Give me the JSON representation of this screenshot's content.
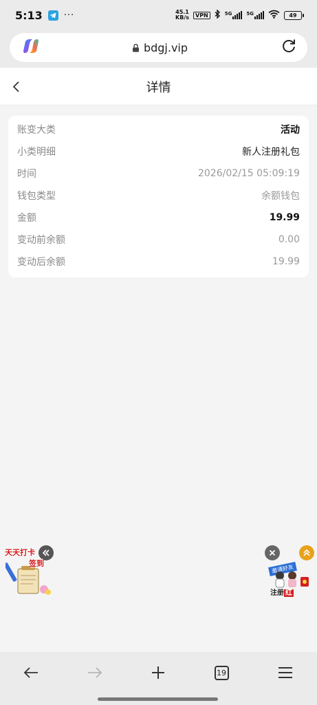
{
  "status_bar": {
    "time": "5:13",
    "dots": "···",
    "net_speed_value": "45.1",
    "net_speed_unit": "KB/s",
    "vpn": "VPN",
    "signal1": "5G",
    "signal2": "5G",
    "battery": "49"
  },
  "browser": {
    "url": "bdgj.vip"
  },
  "page": {
    "title": "详情"
  },
  "detail": {
    "rows": [
      {
        "label": "账变大类",
        "value": "活动"
      },
      {
        "label": "小类明细",
        "value": "新人注册礼包"
      },
      {
        "label": "时间",
        "value": "2026/02/15 05:09:19"
      },
      {
        "label": "钱包类型",
        "value": "余额钱包"
      },
      {
        "label": "金额",
        "value": "19.99"
      },
      {
        "label": "变动前余额",
        "value": "0.00"
      },
      {
        "label": "变动后余额",
        "value": "19.99"
      }
    ]
  },
  "floats": {
    "left_title": "天天打卡",
    "left_sub": "签到",
    "right_banner": "邀请好友",
    "right_bottom_prefix": "注册",
    "right_bottom_red": "红"
  },
  "bottom_nav": {
    "tab_count": "19"
  },
  "colors": {
    "chrome_bg": "#ebebeb",
    "page_bg": "#f4f4f4",
    "card_bg": "#ffffff",
    "label_gray": "#8a8a8a"
  }
}
